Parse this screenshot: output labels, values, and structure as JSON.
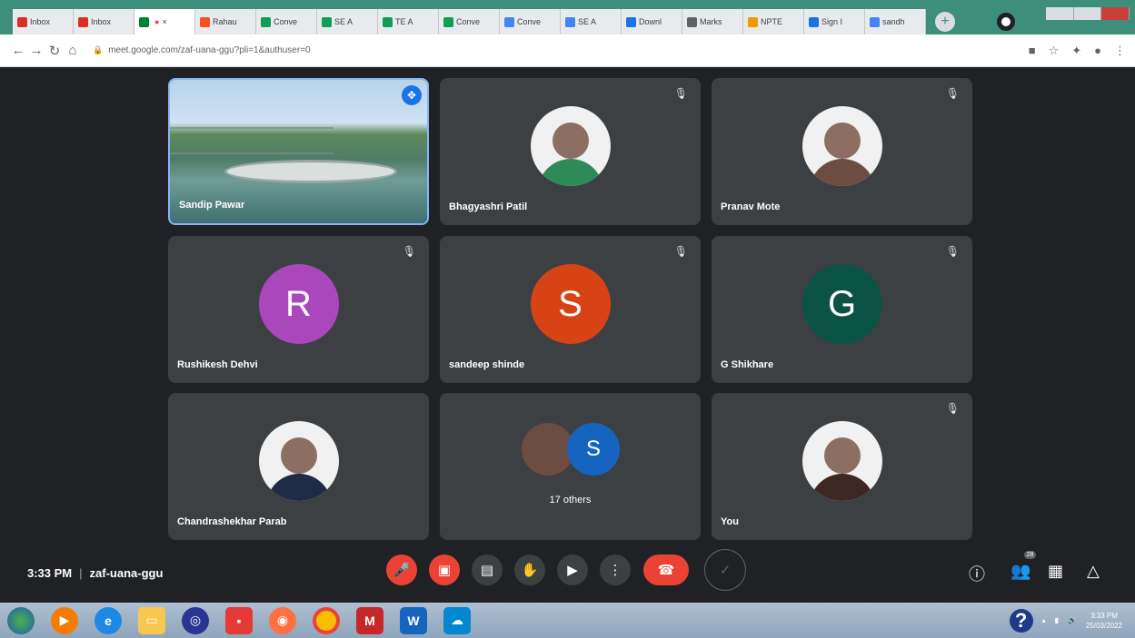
{
  "browser": {
    "tabs": [
      {
        "label": "Inbox",
        "icon": "gmail-icon",
        "color": "#d93025"
      },
      {
        "label": "Inbox",
        "icon": "gmail-icon",
        "color": "#d93025"
      },
      {
        "label": "",
        "icon": "meet-icon",
        "color": "#00832d",
        "active": true
      },
      {
        "label": "Rahau",
        "icon": "doc-icon",
        "color": "#f4511e"
      },
      {
        "label": "Conve",
        "icon": "classroom-icon",
        "color": "#0f9d58"
      },
      {
        "label": "SE A",
        "icon": "classroom-icon",
        "color": "#0f9d58"
      },
      {
        "label": "TE A",
        "icon": "classroom-icon",
        "color": "#0f9d58"
      },
      {
        "label": "Conve",
        "icon": "classroom-icon",
        "color": "#0f9d58"
      },
      {
        "label": "Conve",
        "icon": "google-icon",
        "color": "#4285f4"
      },
      {
        "label": "SE A",
        "icon": "google-icon",
        "color": "#4285f4"
      },
      {
        "label": "Downl",
        "icon": "download-icon",
        "color": "#1a73e8"
      },
      {
        "label": "Marks",
        "icon": "sheet-icon",
        "color": "#5f6368"
      },
      {
        "label": "NPTE",
        "icon": "nptel-icon",
        "color": "#f29900"
      },
      {
        "label": "Sign I",
        "icon": "signin-icon",
        "color": "#1a73e8"
      },
      {
        "label": "sandh",
        "icon": "google-icon",
        "color": "#4285f4"
      }
    ],
    "url": "meet.google.com/zaf-uana-ggu?pli=1&authuser=0",
    "new_tab": "+"
  },
  "tiles": [
    {
      "name": "Sandip Pawar",
      "type": "video",
      "pinned": true
    },
    {
      "name": "Bhagyashri Patil",
      "type": "photo",
      "muted": true,
      "photo_color": "#2e8b57"
    },
    {
      "name": "Pranav Mote",
      "type": "photo",
      "muted": true,
      "photo_color": "#6d4c41"
    },
    {
      "name": "Rushikesh Dehvi",
      "type": "letter",
      "letter": "R",
      "color": "#ab47bc",
      "muted": true
    },
    {
      "name": "sandeep shinde",
      "type": "letter",
      "letter": "S",
      "color": "#d84315",
      "muted": true
    },
    {
      "name": "G Shikhare",
      "type": "letter",
      "letter": "G",
      "color": "#0b5345",
      "muted": true
    },
    {
      "name": "Chandrashekhar Parab",
      "type": "photo",
      "photo_color": "#1f2a44"
    },
    {
      "name": "17 others",
      "type": "others",
      "letter": "S",
      "color": "#1565c0"
    },
    {
      "name": "You",
      "type": "photo",
      "muted": true,
      "photo_color": "#3e2723"
    }
  ],
  "meeting": {
    "time": "3:33 PM",
    "code": "zaf-uana-ggu",
    "participants_count": "28"
  },
  "taskbar": {
    "clock_time": "3:33 PM",
    "clock_date": "25/03/2022",
    "help": "?"
  }
}
